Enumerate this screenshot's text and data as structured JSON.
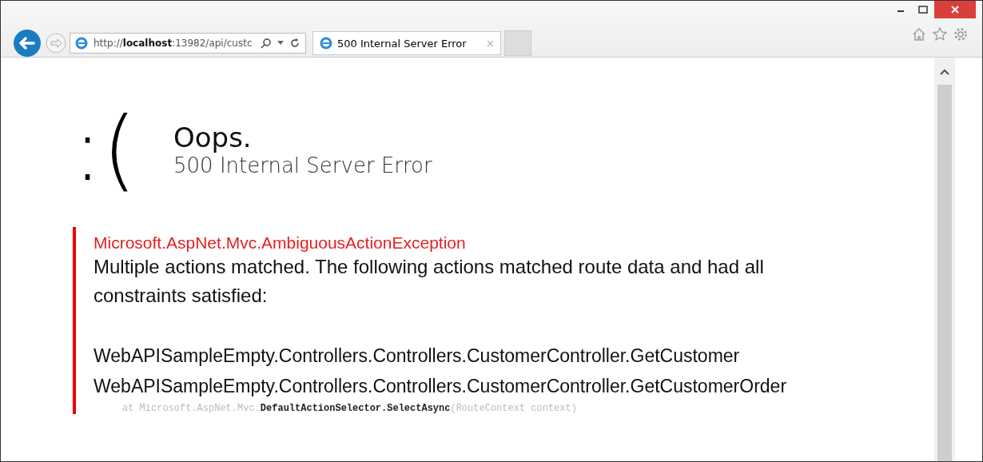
{
  "browser": {
    "address": "http://**localhost**:13982/api/custc",
    "tab": {
      "title": "500 Internal Server Error",
      "selected": true
    }
  },
  "error_page": {
    "face": ":(",
    "title": "Oops.",
    "subtitle": "500 Internal Server Error",
    "exception": "Microsoft.AspNet.Mvc.AmbiguousActionException",
    "message": "Multiple actions matched. The following actions matched route data and had all constraints satisfied:",
    "matches": [
      "WebAPISampleEmpty.Controllers.Controllers.CustomerController.GetCustomer",
      "WebAPISampleEmpty.Controllers.Controllers.CustomerController.GetCustomerOrder"
    ],
    "stack_line": "at Microsoft.AspNet.Mvc.**DefaultActionSelector.SelectAsync**(RouteContext context)"
  }
}
